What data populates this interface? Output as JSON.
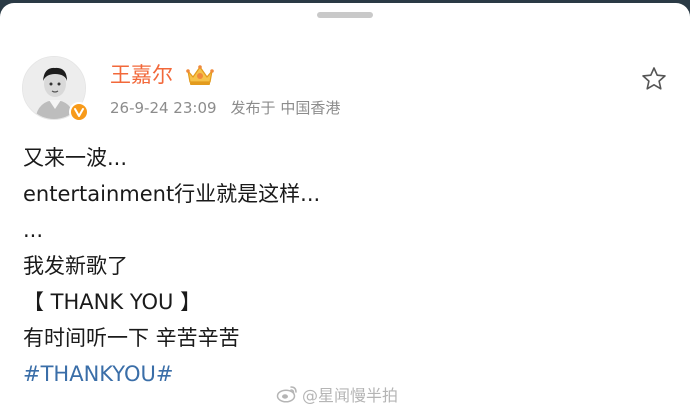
{
  "post": {
    "username": "王嘉尔",
    "timestamp": "26-9-24 23:09",
    "location": "发布于 中国香港",
    "lines": [
      "又来一波...",
      "entertainment行业就是这样...",
      "...",
      "我发新歌了",
      "【 THANK YOU 】",
      "有时间听一下 辛苦辛苦"
    ],
    "hashtag": "#THANKYOU#"
  },
  "icons": {
    "avatar": "user-avatar-photo",
    "verified": "verified-badge-icon",
    "crown": "vip-crown-icon",
    "favorite": "star-outline-icon",
    "weibo": "weibo-logo-icon"
  },
  "colors": {
    "username": "#f2683a",
    "hashtag": "#3a6ea8",
    "verified": "#f79a1a",
    "meta": "#8c8c8c"
  },
  "watermark": {
    "text": "@星闻慢半拍"
  }
}
